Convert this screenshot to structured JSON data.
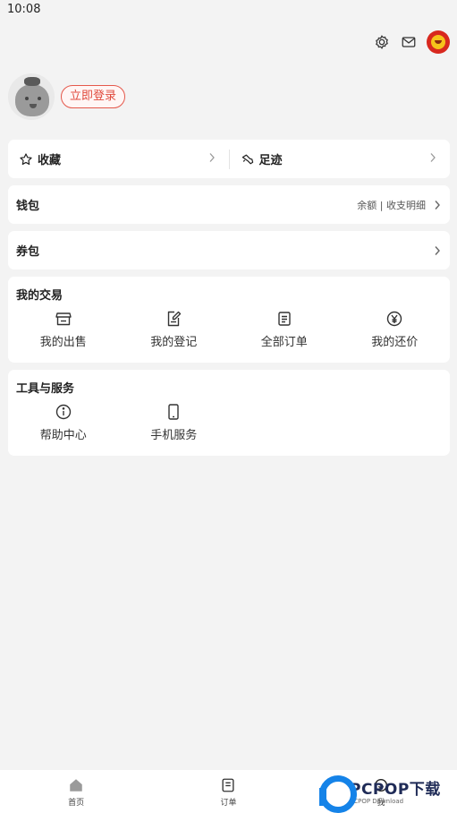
{
  "status_bar": {
    "time": "10:08"
  },
  "profile": {
    "login_label": "立即登录"
  },
  "favorites": {
    "collect_label": "收藏",
    "footprint_label": "足迹"
  },
  "wallet": {
    "title": "钱包",
    "sub": "余额 | 收支明细"
  },
  "coupons": {
    "title": "券包"
  },
  "trades": {
    "title": "我的交易",
    "items": [
      {
        "label": "我的出售",
        "icon": "shop-icon"
      },
      {
        "label": "我的登记",
        "icon": "register-icon"
      },
      {
        "label": "全部订单",
        "icon": "orders-icon"
      },
      {
        "label": "我的还价",
        "icon": "yen-icon"
      }
    ]
  },
  "tools": {
    "title": "工具与服务",
    "items": [
      {
        "label": "帮助中心",
        "icon": "info-icon"
      },
      {
        "label": "手机服务",
        "icon": "phone-icon"
      }
    ]
  },
  "tabbar": {
    "tabs": [
      {
        "label": "首页",
        "icon": "home-icon"
      },
      {
        "label": "订单",
        "icon": "order-icon"
      },
      {
        "label": "我",
        "icon": "me-icon"
      }
    ]
  },
  "watermark": {
    "brand": "PCPOP下载",
    "sub": "PCPOP Download"
  },
  "colors": {
    "accent": "#e04a3d",
    "watermark_blue": "#1583e8"
  }
}
